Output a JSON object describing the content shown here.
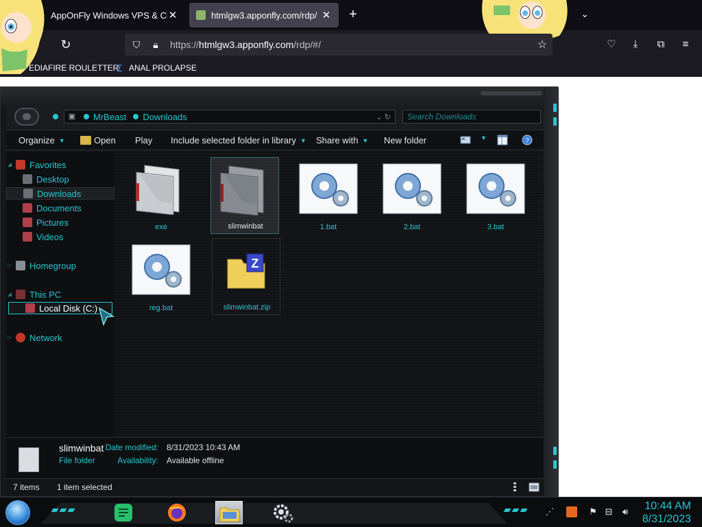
{
  "browser": {
    "tabs": [
      {
        "title": "AppOnFly Windows VPS & Clo",
        "active": false
      },
      {
        "title": "htmlgw3.apponfly.com/rdp/",
        "active": true
      }
    ],
    "new_tab_icon": "plus-icon",
    "url_prefix": "https://",
    "url_host": "htmlgw3.apponfly.com",
    "url_path": "/rdp/#/",
    "bookmarks": [
      {
        "label": "EDIAFIRE ROULETTER"
      },
      {
        "label": "ANAL PROLAPSE"
      }
    ]
  },
  "explorer": {
    "breadcrumb": [
      "MrBeast",
      "Downloads"
    ],
    "search_placeholder": "Search Downloads",
    "toolbar": {
      "organize": "Organize",
      "open": "Open",
      "play": "Play",
      "include": "Include selected folder in library",
      "share": "Share with",
      "new_folder": "New folder"
    },
    "nav": {
      "favorites": "Favorites",
      "desktop": "Desktop",
      "downloads": "Downloads",
      "documents": "Documents",
      "pictures": "Pictures",
      "videos": "Videos",
      "homegroup": "Homegroup",
      "this_pc": "This PC",
      "local_disk": "Local Disk (C:)",
      "network": "Network"
    },
    "files": [
      {
        "name": "exe",
        "kind": "folder"
      },
      {
        "name": "slimwinbat",
        "kind": "folder",
        "selected": true
      },
      {
        "name": "1.bat",
        "kind": "bat"
      },
      {
        "name": "2.bat",
        "kind": "bat"
      },
      {
        "name": "3.bat",
        "kind": "bat"
      },
      {
        "name": "reg.bat",
        "kind": "bat"
      },
      {
        "name": "slimwinbat.zip",
        "kind": "zip"
      }
    ],
    "details": {
      "name": "slimwinbat",
      "type": "File folder",
      "date_label": "Date modified:",
      "date_value": "8/31/2023 10:43 AM",
      "avail_label": "Availability:",
      "avail_value": "Available offline"
    },
    "status": {
      "count": "7 items",
      "selected": "1 item selected"
    }
  },
  "taskbar": {
    "time": "10:44 AM",
    "date": "8/31/2023"
  },
  "colors": {
    "accent": "#27c7d0",
    "window_bg": "#16171a"
  }
}
